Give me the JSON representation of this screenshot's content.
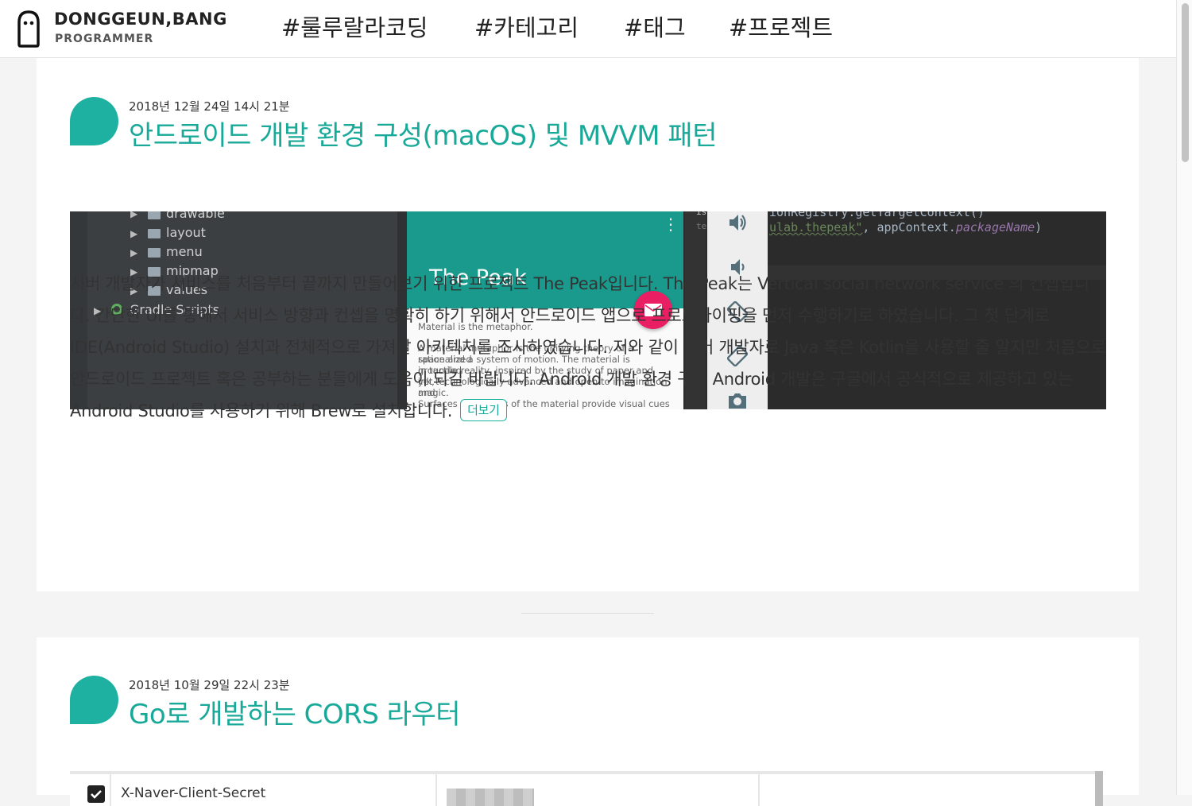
{
  "header": {
    "brand_name": "DONGGEUN,BANG",
    "brand_sub": "PROGRAMMER",
    "nav": [
      {
        "label": "#룰루랄라코딩"
      },
      {
        "label": "#카테고리"
      },
      {
        "label": "#태그"
      },
      {
        "label": "#프로젝트"
      }
    ]
  },
  "posts": [
    {
      "date": "2018년 12월 24일 14시 21분",
      "title": "안드로이드 개발 환경 구성(macOS) 및 MVVM 패턴",
      "excerpt": "서버 개발자가 서비스를 처음부터 끝까지 만들어보기 위한 프로젝트 The Peak입니다. The Peak는 Vertical social network service 의 컨셉입니다. 간단한 UI를 통해서 서비스 방향과 컨셉을 명확히 하기 위해서 안드로이드 앱으로 프로토타이핑을 먼저 수행하기로 하였습니다. 그 첫 단계로 IDE(Android Studio) 설치과 전체적으로 가져갈 아키텍처를 조사하였습니다. 저와 같이 서버 개발자로 Java 혹은 Kotlin을 사용할 줄 알지만 처음으로 안드로이드 프로젝트 혹은 공부하는 분들에게 도움이 되길 바랍니다. Android 개발 환경 구축 Android 개발은 구글에서 공식적으로 제공하고 있는 Android Studio를 사용하기 위해 Brew로 설치합니다.",
      "more_label": "더보기",
      "image": {
        "tree": [
          "drawable",
          "layout",
          "menu",
          "mipmap",
          "values",
          "Gradle Scripts"
        ],
        "app_title": "The Peak",
        "app_heading": "Material is the metaphor.",
        "app_body": [
          " A material metaphor is the unifying theory of a rationalized",
          "space and a system of motion. The material is grounded",
          "in tactile reality, inspired by the study of paper and ink,",
          "yet  technologically advanced and open to imagination and",
          "magic.",
          " Surfaces and edges of the material provide visual cues"
        ],
        "code_line1": "ionRegistry.getTargetContext()",
        "code_str": "ulab.thepeak\"",
        "code_mid": ", appContext.",
        "code_field": "packageName",
        "code_end": ")",
        "gutter1": "is",
        "gutter2": "te"
      }
    },
    {
      "date": "2018년 10월 29일 22시 23분",
      "title": "Go로 개발하는 CORS 라우터",
      "table_cell": "X-Naver-Client-Secret"
    }
  ],
  "colors": {
    "accent": "#1eb1a1",
    "title": "#18a999",
    "fab": "#e91e63",
    "app_bar": "#1a9a8c"
  }
}
